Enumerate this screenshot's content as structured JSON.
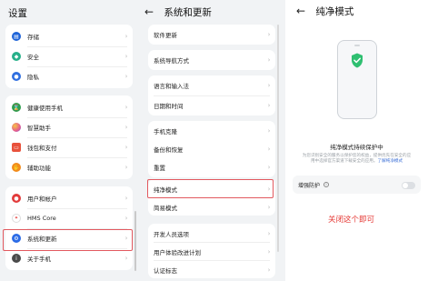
{
  "settings": {
    "title": "设置",
    "groups": [
      [
        {
          "label": "存储",
          "icon": "storage-icon",
          "color": "#1d63d8"
        },
        {
          "label": "安全",
          "icon": "security-icon",
          "color": "#27b08a"
        },
        {
          "label": "隐私",
          "icon": "privacy-icon",
          "color": "#2f6fe0"
        }
      ],
      [
        {
          "label": "健康使用手机",
          "icon": "health-icon",
          "color": "#2e9f4f"
        },
        {
          "label": "智慧助手",
          "icon": "assistant-icon",
          "color": "#e55b8e"
        },
        {
          "label": "钱包和支付",
          "icon": "wallet-icon",
          "color": "#e8523c"
        },
        {
          "label": "辅助功能",
          "icon": "accessibility-icon",
          "color": "#f28b1c"
        }
      ],
      [
        {
          "label": "用户和帐户",
          "icon": "user-icon",
          "color": "#e23b3b"
        },
        {
          "label": "HMS Core",
          "icon": "hms-core-icon",
          "color": "#ffffff"
        },
        {
          "label": "系统和更新",
          "icon": "system-update-icon",
          "color": "#2b6be6"
        },
        {
          "label": "关于手机",
          "icon": "about-phone-icon",
          "color": "#4a4a4a"
        }
      ]
    ]
  },
  "system": {
    "title": "系统和更新",
    "back_icon": "back-arrow-icon",
    "groups": [
      [
        "软件更新"
      ],
      [
        "系统导航方式"
      ],
      [
        "语言和输入法",
        "日期和时间"
      ],
      [
        "手机克隆",
        "备份和恢复",
        "重置"
      ],
      [
        "纯净模式",
        "简易模式"
      ],
      [
        "开发人员选项",
        "用户体验改进计划",
        "认证标志"
      ]
    ]
  },
  "pure_mode": {
    "title": "纯净模式",
    "back_icon": "back-arrow-icon",
    "heading": "纯净模式持续保护中",
    "description": "为您识别安全的服务以保护您的权益，提供优先在安全的应用中选择官方渠道下载安全的应用。",
    "learn_more": "了解纯净模式",
    "toggle_label": "增强防护",
    "toggle_on": false
  },
  "annotation": "关闭这个即可",
  "colors": {
    "highlight": "#e2595f",
    "annotation": "#e53935",
    "shield": "#2fbf71",
    "link": "#3b6fd6"
  }
}
